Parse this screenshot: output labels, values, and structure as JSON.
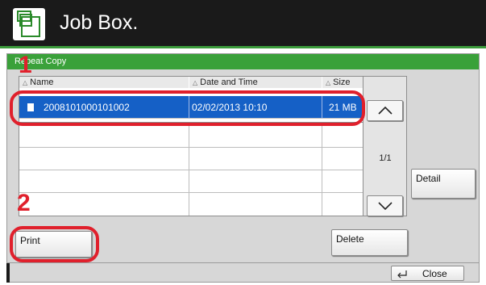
{
  "header": {
    "title": "Job Box.",
    "icon": "job-box-icon"
  },
  "panel": {
    "title": "Repeat Copy"
  },
  "table": {
    "columns": [
      "Name",
      "Date and Time",
      "Size"
    ],
    "rows": [
      {
        "name": "2008101000101002",
        "datetime": "02/02/2013  10:10",
        "size": "21 MB",
        "selected": true
      },
      {
        "name": "",
        "datetime": "",
        "size": "",
        "selected": false
      },
      {
        "name": "",
        "datetime": "",
        "size": "",
        "selected": false
      },
      {
        "name": "",
        "datetime": "",
        "size": "",
        "selected": false
      },
      {
        "name": "",
        "datetime": "",
        "size": "",
        "selected": false
      }
    ]
  },
  "pagination": {
    "indicator": "1/1"
  },
  "buttons": {
    "detail": "Detail",
    "print": "Print",
    "delete": "Delete",
    "close": "Close"
  },
  "annotations": {
    "step1": "1",
    "step2": "2"
  },
  "colors": {
    "accent_green": "#3aa13a",
    "selection_blue": "#1560c6",
    "annotation_red": "#e0202c"
  }
}
